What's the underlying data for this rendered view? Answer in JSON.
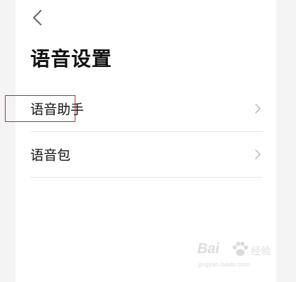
{
  "header": {
    "back_icon": "chevron-left-icon",
    "title": "语音设置"
  },
  "settings_list": {
    "items": [
      {
        "label": "语音助手",
        "icon": "chevron-right-icon",
        "highlighted": true
      },
      {
        "label": "语音包",
        "icon": "chevron-right-icon",
        "highlighted": false
      }
    ]
  },
  "highlight": {
    "color": "#c9242b"
  },
  "watermark": {
    "brand": "Bai",
    "paw_icon": "paw-icon",
    "cn": "经验",
    "url": "jingyan.baidu.com"
  },
  "colors": {
    "background": "#f4f4f4",
    "surface": "#ffffff",
    "text": "#111111",
    "divider": "#e8e8e8",
    "chevron": "#b8b8b8"
  }
}
